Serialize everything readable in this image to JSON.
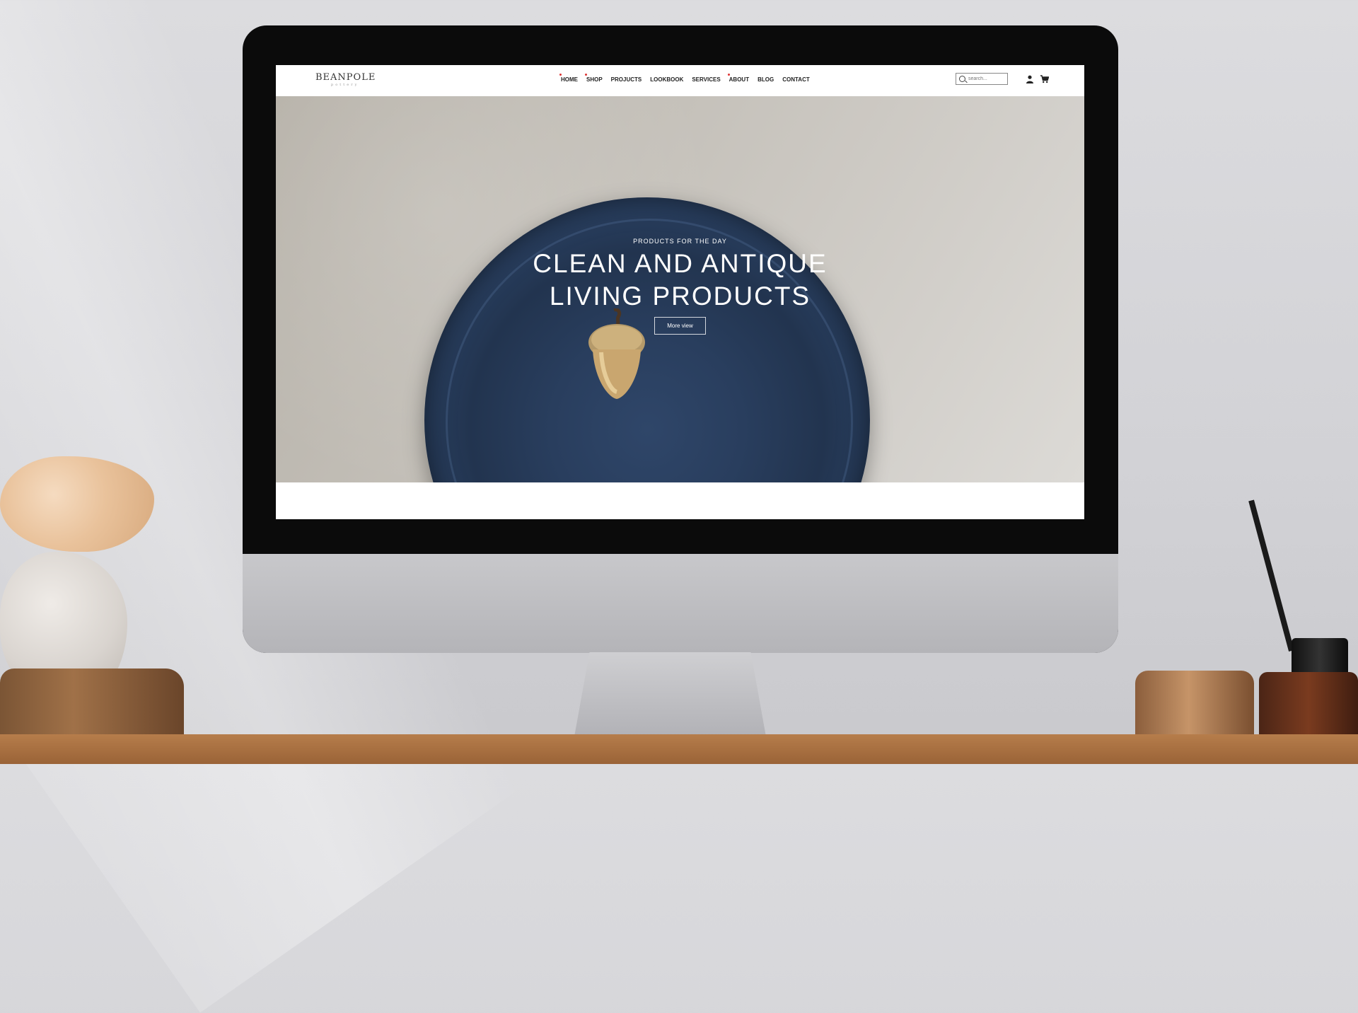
{
  "site": {
    "logo": "BEANPOLE",
    "logo_sub": "pottery"
  },
  "nav": {
    "items": [
      "HOME",
      "SHOP",
      "PROJUCTS",
      "LOOKBOOK",
      "SERVICES",
      "ABOUT",
      "BLOG",
      "CONTACT"
    ]
  },
  "search": {
    "placeholder": "search..."
  },
  "hero": {
    "subtitle": "PRODUCTS FOR THE DAY",
    "title_line1": "CLEAN AND ANTIQUE",
    "title_line2": "LIVING PRODUCTS",
    "button": "More view"
  },
  "icons": {
    "account": "user-icon",
    "cart": "cart-icon",
    "search": "search-icon"
  },
  "colors": {
    "accent": "#d33333",
    "text": "#222222",
    "plate": "#2a3f61"
  }
}
